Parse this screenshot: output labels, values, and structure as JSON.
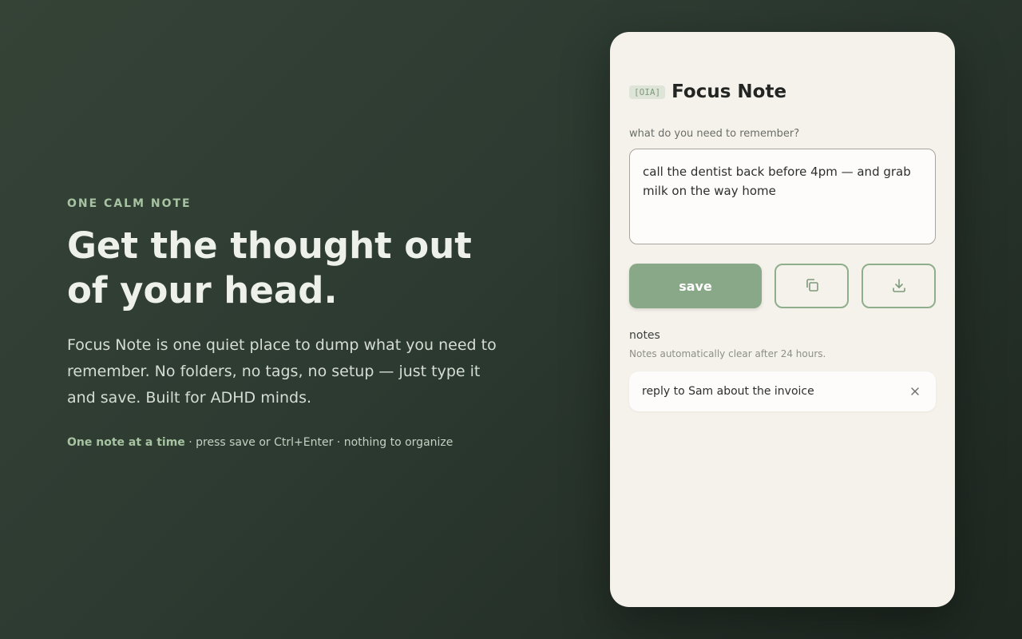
{
  "hero": {
    "eyebrow": "ONE CALM NOTE",
    "headline": "Get the thought out of your head.",
    "lede": "Focus Note is one quiet place to dump what you need to remember. No folders, no tags, no setup — just type it and save. Built for ADHD minds.",
    "hint_strong": "One note at a time",
    "hint_rest": " · press save or Ctrl+Enter · nothing to organize"
  },
  "card": {
    "badge": "[OIA]",
    "title": "Focus Note",
    "field_label": "what do you need to remember?",
    "textarea_value": "call the dentist back before 4pm — and grab milk on the way home",
    "save_label": "save",
    "copy_icon": "copy-icon",
    "download_icon": "download-icon",
    "notes_label": "notes",
    "notes_sub": "Notes automatically clear after 24 hours.",
    "notes": [
      {
        "text": "reply to Sam about the invoice",
        "close_icon": "close-icon"
      }
    ]
  },
  "colors": {
    "accent": "#89a887",
    "eyebrow": "#a7c3a1",
    "card_bg": "#f5f1eb",
    "page_bg": "#2c3a31"
  }
}
